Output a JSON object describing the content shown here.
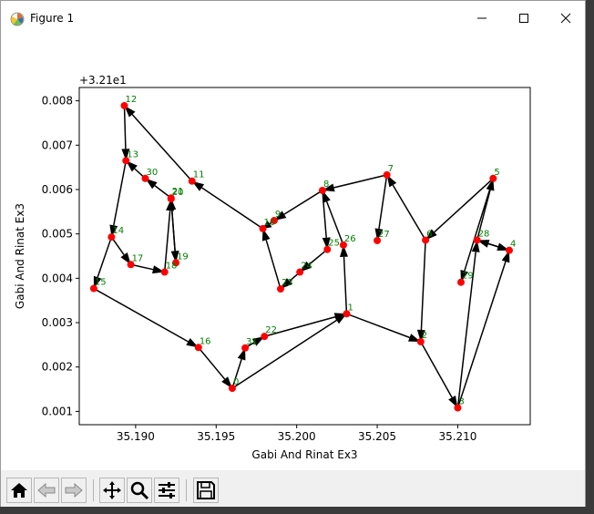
{
  "window": {
    "title": "Figure 1",
    "controls": [
      "minimize",
      "maximize",
      "close"
    ]
  },
  "toolbar": {
    "buttons": [
      {
        "name": "home",
        "icon": "home-icon"
      },
      {
        "name": "back",
        "icon": "back-arrow-icon"
      },
      {
        "name": "forward",
        "icon": "forward-arrow-icon"
      },
      {
        "name": "pan",
        "icon": "pan-move-icon"
      },
      {
        "name": "zoom",
        "icon": "zoom-magnifier-icon"
      },
      {
        "name": "configure",
        "icon": "sliders-icon"
      },
      {
        "name": "save",
        "icon": "floppy-disk-icon"
      }
    ]
  },
  "chart_data": {
    "type": "scatter",
    "offset_label": "+3.21e1",
    "xlabel": "Gabi And Rinat Ex3",
    "ylabel": "Gabi And Rinat Ex3",
    "xlim": [
      35.1865,
      35.2145
    ],
    "ylim": [
      0.0007,
      0.0083
    ],
    "xticks": [
      35.19,
      35.195,
      35.2,
      35.205,
      35.21
    ],
    "xtick_labels": [
      "35.190",
      "35.195",
      "35.200",
      "35.205",
      "35.210"
    ],
    "yticks": [
      0.001,
      0.002,
      0.003,
      0.004,
      0.005,
      0.006,
      0.007,
      0.008
    ],
    "ytick_labels": [
      "0.001",
      "0.002",
      "0.003",
      "0.004",
      "0.005",
      "0.006",
      "0.007",
      "0.008"
    ],
    "point_color": "#ff0000",
    "label_color": "#008000",
    "grid": false,
    "points": [
      {
        "label": "0",
        "x": 35.196,
        "y": 0.00152
      },
      {
        "label": "1",
        "x": 35.2031,
        "y": 0.0032
      },
      {
        "label": "2",
        "x": 35.2077,
        "y": 0.00257
      },
      {
        "label": "3",
        "x": 35.21,
        "y": 0.00108
      },
      {
        "label": "4",
        "x": 35.2132,
        "y": 0.00463
      },
      {
        "label": "5",
        "x": 35.2122,
        "y": 0.00625
      },
      {
        "label": "6",
        "x": 35.208,
        "y": 0.00486
      },
      {
        "label": "7",
        "x": 35.2056,
        "y": 0.00633
      },
      {
        "label": "8",
        "x": 35.2016,
        "y": 0.00598
      },
      {
        "label": "9",
        "x": 35.1986,
        "y": 0.0053
      },
      {
        "label": "10",
        "x": 35.1979,
        "y": 0.00512
      },
      {
        "label": "11",
        "x": 35.1935,
        "y": 0.00619
      },
      {
        "label": "12",
        "x": 35.1893,
        "y": 0.00789
      },
      {
        "label": "13",
        "x": 35.1894,
        "y": 0.00665
      },
      {
        "label": "14",
        "x": 35.1885,
        "y": 0.00493
      },
      {
        "label": "15",
        "x": 35.1874,
        "y": 0.00377
      },
      {
        "label": "16",
        "x": 35.1939,
        "y": 0.00244
      },
      {
        "label": "17",
        "x": 35.1897,
        "y": 0.00431
      },
      {
        "label": "18",
        "x": 35.1918,
        "y": 0.00414
      },
      {
        "label": "19",
        "x": 35.1925,
        "y": 0.00435
      },
      {
        "label": "20",
        "x": 35.1922,
        "y": 0.00579
      },
      {
        "label": "21",
        "x": 35.1922,
        "y": 0.00581
      },
      {
        "label": "22",
        "x": 35.198,
        "y": 0.00269
      },
      {
        "label": "23",
        "x": 35.199,
        "y": 0.00376
      },
      {
        "label": "24",
        "x": 35.2002,
        "y": 0.00414
      },
      {
        "label": "25",
        "x": 35.2019,
        "y": 0.00465
      },
      {
        "label": "26",
        "x": 35.2029,
        "y": 0.00475
      },
      {
        "label": "27",
        "x": 35.205,
        "y": 0.00485
      },
      {
        "label": "28",
        "x": 35.2112,
        "y": 0.00486
      },
      {
        "label": "29",
        "x": 35.2102,
        "y": 0.00391
      },
      {
        "label": "30",
        "x": 35.1906,
        "y": 0.00625
      },
      {
        "label": "31",
        "x": 35.1968,
        "y": 0.00243
      }
    ],
    "edges": [
      [
        "0",
        "1"
      ],
      [
        "1",
        "2"
      ],
      [
        "2",
        "3"
      ],
      [
        "3",
        "4"
      ],
      [
        "4",
        "28"
      ],
      [
        "28",
        "5"
      ],
      [
        "5",
        "6"
      ],
      [
        "6",
        "7"
      ],
      [
        "7",
        "8"
      ],
      [
        "8",
        "9"
      ],
      [
        "9",
        "10"
      ],
      [
        "10",
        "11"
      ],
      [
        "11",
        "12"
      ],
      [
        "12",
        "13"
      ],
      [
        "13",
        "14"
      ],
      [
        "14",
        "15"
      ],
      [
        "15",
        "16"
      ],
      [
        "16",
        "0"
      ],
      [
        "0",
        "31"
      ],
      [
        "31",
        "22"
      ],
      [
        "22",
        "1"
      ],
      [
        "1",
        "26"
      ],
      [
        "26",
        "8"
      ],
      [
        "8",
        "25"
      ],
      [
        "25",
        "24"
      ],
      [
        "24",
        "23"
      ],
      [
        "23",
        "10"
      ],
      [
        "14",
        "17"
      ],
      [
        "17",
        "18"
      ],
      [
        "18",
        "20"
      ],
      [
        "20",
        "19"
      ],
      [
        "19",
        "21"
      ],
      [
        "21",
        "30"
      ],
      [
        "30",
        "13"
      ],
      [
        "7",
        "27"
      ],
      [
        "5",
        "29"
      ],
      [
        "28",
        "4"
      ],
      [
        "6",
        "2"
      ],
      [
        "3",
        "28"
      ]
    ]
  }
}
